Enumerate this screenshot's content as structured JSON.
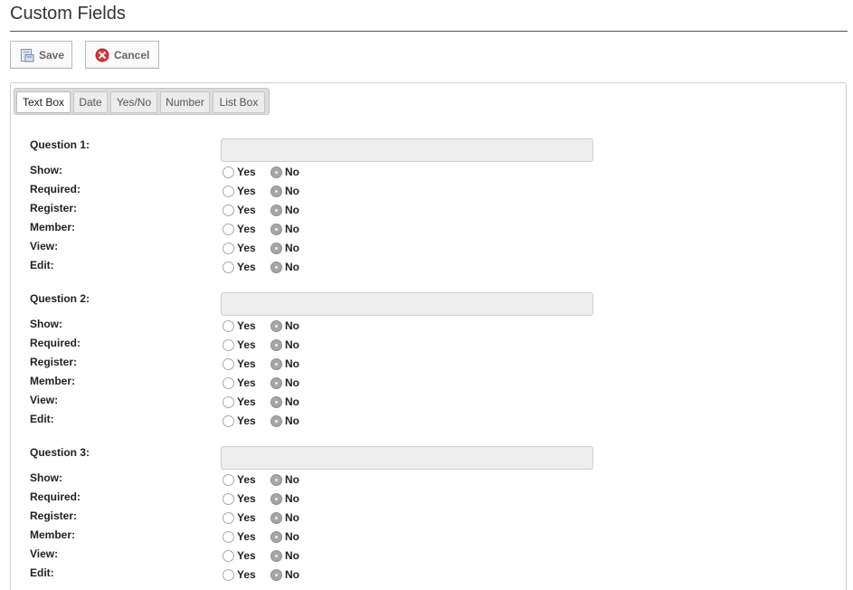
{
  "header": {
    "title": "Custom Fields"
  },
  "toolbar": {
    "save_label": "Save",
    "cancel_label": "Cancel"
  },
  "tabs": [
    {
      "label": "Text Box",
      "active": true
    },
    {
      "label": "Date"
    },
    {
      "label": "Yes/No"
    },
    {
      "label": "Number"
    },
    {
      "label": "List Box"
    }
  ],
  "questions": [
    {
      "label": "Question 1:",
      "value": "",
      "options": [
        {
          "label": "Show:",
          "selected": "No"
        },
        {
          "label": "Required:",
          "selected": "No"
        },
        {
          "label": "Register:",
          "selected": "No"
        },
        {
          "label": "Member:",
          "selected": "No"
        },
        {
          "label": "View:",
          "selected": "No"
        },
        {
          "label": "Edit:",
          "selected": "No"
        }
      ]
    },
    {
      "label": "Question 2:",
      "value": "",
      "options": [
        {
          "label": "Show:",
          "selected": "No"
        },
        {
          "label": "Required:",
          "selected": "No"
        },
        {
          "label": "Register:",
          "selected": "No"
        },
        {
          "label": "Member:",
          "selected": "No"
        },
        {
          "label": "View:",
          "selected": "No"
        },
        {
          "label": "Edit:",
          "selected": "No"
        }
      ]
    },
    {
      "label": "Question 3:",
      "value": "",
      "options": [
        {
          "label": "Show:",
          "selected": "No"
        },
        {
          "label": "Required:",
          "selected": "No"
        },
        {
          "label": "Register:",
          "selected": "No"
        },
        {
          "label": "Member:",
          "selected": "No"
        },
        {
          "label": "View:",
          "selected": "No"
        },
        {
          "label": "Edit:",
          "selected": "No"
        }
      ]
    }
  ],
  "radio_labels": {
    "yes": "Yes",
    "no": "No"
  },
  "icons": {
    "save": "save-icon",
    "cancel": "cancel-icon"
  },
  "colors": {
    "cancel_icon": "#d9363b",
    "radio_checked": "#a6a6a6",
    "input_bg": "#ededed"
  }
}
